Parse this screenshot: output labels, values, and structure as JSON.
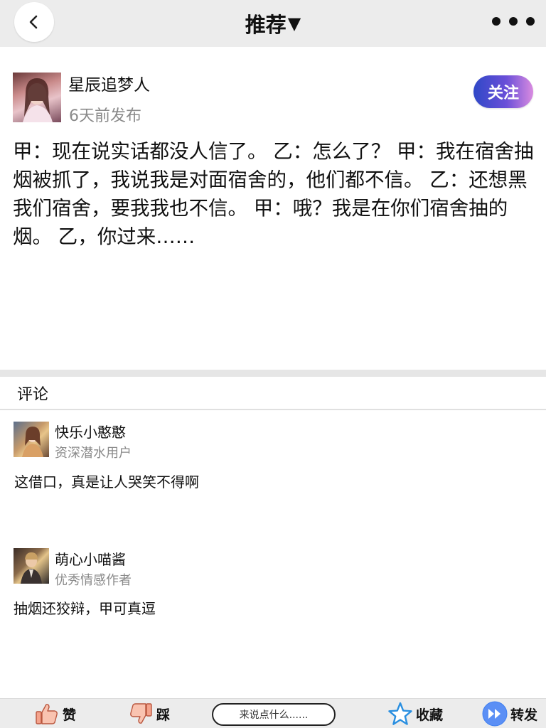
{
  "header": {
    "title": "推荐",
    "dropdown_glyph": "▼"
  },
  "post": {
    "author": "星辰追梦人",
    "time": "6天前发布",
    "follow_label": "关注",
    "body": "甲：现在说实话都没人信了。 乙：怎么了？ 甲：我在宿舍抽烟被抓了，我说我是对面宿舍的，他们都不信。 乙：还想黑我们宿舍，要我我也不信。 甲：哦？我是在你们宿舍抽的烟。 乙，你过来……"
  },
  "comments": {
    "title": "评论",
    "items": [
      {
        "name": "快乐小憨憨",
        "role": "资深潜水用户",
        "text": "这借口，真是让人哭笑不得啊"
      },
      {
        "name": "萌心小喵酱",
        "role": "优秀情感作者",
        "text": "抽烟还狡辩，甲可真逗"
      }
    ]
  },
  "bottombar": {
    "like_label": "赞",
    "dislike_label": "踩",
    "input_placeholder": "来说点什么......",
    "collect_label": "收藏",
    "share_label": "转发"
  },
  "colors": {
    "follow_gradient_start": "#2f48c7",
    "follow_gradient_end": "#d98be0",
    "header_bg": "#ececec",
    "meta_text": "#8a8a8a",
    "star_blue": "#2a8fe0",
    "share_blue": "#3f7ff0"
  },
  "icons": [
    "back-icon",
    "more-icon",
    "thumbs-up-icon",
    "thumbs-down-icon",
    "star-icon",
    "share-forward-icon"
  ]
}
